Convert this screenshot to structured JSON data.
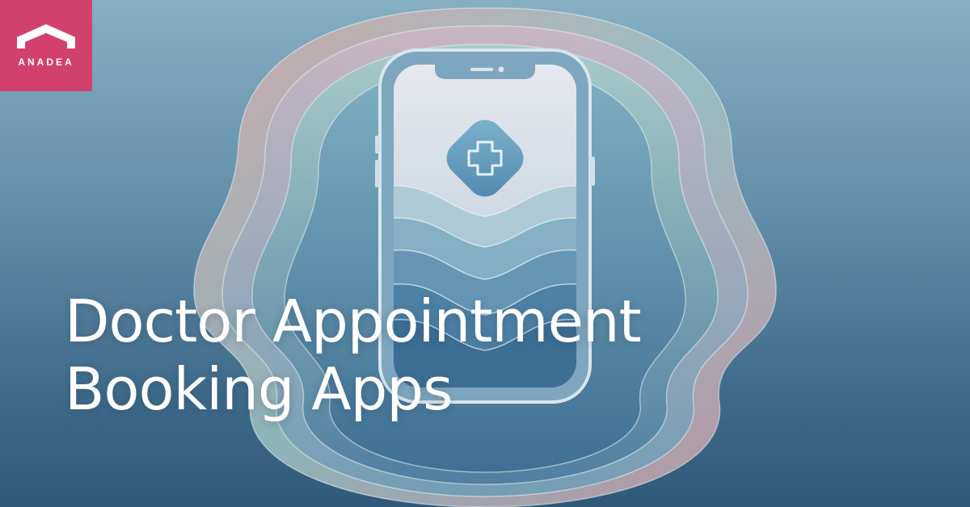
{
  "logo": {
    "brand_name": "ANADEA",
    "icon": "house-roof-icon"
  },
  "headline": {
    "line1": "Doctor Appointment",
    "line2": "Booking Apps"
  },
  "illustration": {
    "device": "smartphone-icon",
    "screen_icon": "medical-cross-icon"
  },
  "colors": {
    "background_top": "#86afc2",
    "background_bottom": "#2f5979",
    "logo_background": "#d2406d",
    "text": "#ffffff"
  }
}
